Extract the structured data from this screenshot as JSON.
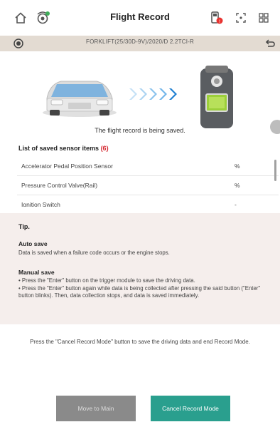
{
  "header": {
    "title": "Flight Record"
  },
  "vehicle": {
    "name": "FORKLIFT(25/30D-9V)/2020/D 2.2TCI-R"
  },
  "status": {
    "saving_text": "The flight record is being saved."
  },
  "sensor_list": {
    "heading": "List of saved sensor items",
    "count": "(6)",
    "items": [
      {
        "name": "Accelerator Pedal Position Sensor",
        "unit": "%"
      },
      {
        "name": "Pressure Control Valve(Rail)",
        "unit": "%"
      },
      {
        "name": "Ignition Switch",
        "unit": "-"
      }
    ]
  },
  "tip": {
    "title": "Tip.",
    "auto_title": "Auto save",
    "auto_text": "Data is saved when a failure code occurs or the engine stops.",
    "manual_title": "Manual save",
    "manual_items": [
      "• Press the \"Enter\" button on the trigger module to save the driving data.",
      "• Press the \"Enter\" button again while data is being collected after pressing the said button (\"Enter\" button blinks). Then, data collection stops, and data is saved immediately."
    ]
  },
  "note": "Press the \"Cancel Record Mode\" button to save the driving data and end Record Mode.",
  "buttons": {
    "move_to_main": "Move to Main",
    "cancel_record": "Cancel Record Mode"
  },
  "colors": {
    "accent": "#2a9f8e",
    "count_red": "#d4262e"
  }
}
